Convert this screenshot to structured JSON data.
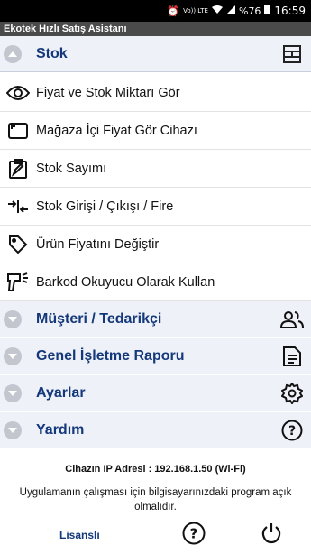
{
  "statusbar": {
    "network": "Vo)) LTE",
    "battery": "%76",
    "time": "16:59"
  },
  "app": {
    "title": "Ekotek Hızlı Satış Asistanı"
  },
  "stok": {
    "label": "Stok",
    "items": [
      {
        "label": "Fiyat ve Stok Miktarı Gör",
        "icon": "eye-icon"
      },
      {
        "label": "Mağaza İçi Fiyat Gör Cihazı",
        "icon": "monitor-icon"
      },
      {
        "label": "Stok Sayımı",
        "icon": "clipboard-edit-icon"
      },
      {
        "label": "Stok Girişi / Çıkışı / Fire",
        "icon": "arrows-in-out-icon"
      },
      {
        "label": "Ürün Fiyatını Değiştir",
        "icon": "price-tag-icon"
      },
      {
        "label": "Barkod Okuyucu Olarak Kullan",
        "icon": "barcode-scanner-icon"
      }
    ]
  },
  "sections": {
    "musteri": "Müşteri / Tedarikçi",
    "rapor": "Genel İşletme Raporu",
    "ayarlar": "Ayarlar",
    "yardim": "Yardım"
  },
  "footer": {
    "ip": "Cihazın IP Adresi : 192.168.1.50 (Wi-Fi)",
    "note": "Uygulamanın çalışması için bilgisayarınızdaki program açık olmalıdır.",
    "license": "Lisanslı"
  }
}
